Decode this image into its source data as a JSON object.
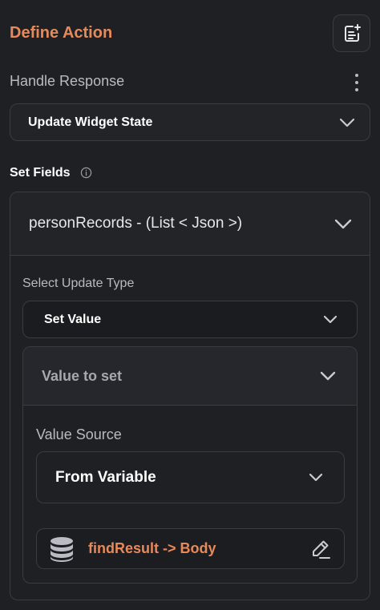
{
  "header": {
    "title": "Define Action",
    "action_icon": "note-add-icon"
  },
  "response": {
    "label": "Handle Response",
    "menu_icon": "more-vertical-icon",
    "selected": "Update Widget State"
  },
  "set_fields": {
    "label": "Set Fields",
    "info_icon": "info-icon",
    "field": {
      "name": "personRecords - (List < Json >)",
      "update_type_label": "Select Update Type",
      "update_type": "Set Value",
      "value_panel": {
        "title": "Value to set",
        "source_label": "Value Source",
        "source": "From Variable",
        "variable": {
          "icon": "database-icon",
          "text": "findResult -> Body",
          "edit_icon": "edit-pencil-icon"
        }
      }
    }
  },
  "colors": {
    "accent": "#e8895a",
    "background": "#1f2024",
    "border": "#3a3c42"
  }
}
